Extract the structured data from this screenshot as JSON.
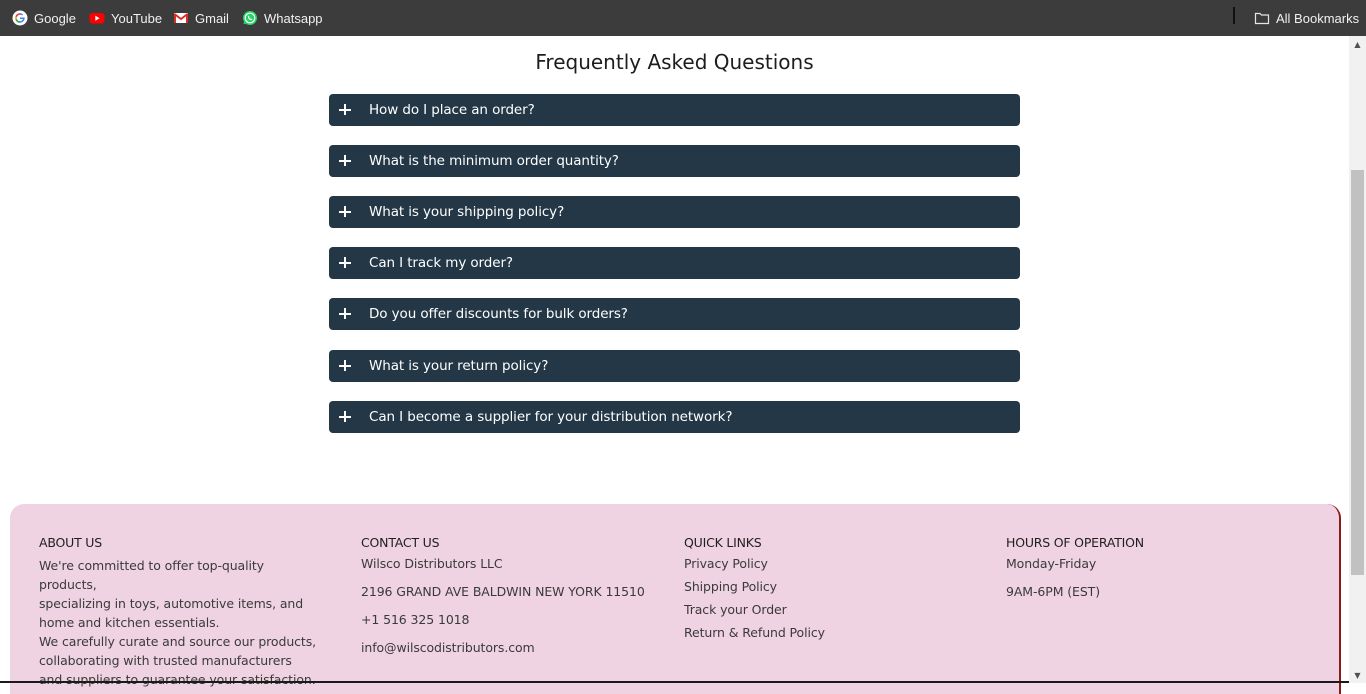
{
  "bookmarks": {
    "items": [
      {
        "label": "Google",
        "icon": "google-icon"
      },
      {
        "label": "YouTube",
        "icon": "youtube-icon"
      },
      {
        "label": "Gmail",
        "icon": "gmail-icon"
      },
      {
        "label": "Whatsapp",
        "icon": "whatsapp-icon"
      }
    ],
    "all_label": "All Bookmarks"
  },
  "faq": {
    "title": "Frequently Asked Questions",
    "questions": [
      "How do I place an order?",
      "What is the minimum order quantity?",
      "What is your shipping policy?",
      "Can I track my order?",
      "Do you offer discounts for bulk orders?",
      "What is your return policy?",
      "Can I become a supplier for your distribution network?"
    ]
  },
  "footer": {
    "about": {
      "heading": "ABOUT US",
      "lines": [
        "We're committed to offer top-quality",
        "products,",
        "specializing in toys, automotive items, and",
        "home and kitchen essentials.",
        "We carefully curate and source our products,",
        "collaborating with trusted manufacturers",
        "and suppliers to guarantee your satisfaction."
      ]
    },
    "contact": {
      "heading": "CONTACT US",
      "company": "Wilsco Distributors LLC",
      "address": "2196 GRAND AVE BALDWIN NEW YORK 11510",
      "phone": "+1 516 325 1018",
      "email": "info@wilscodistributors.com"
    },
    "quick_links": {
      "heading": "QUICK LINKS",
      "links": [
        "Privacy Policy",
        "Shipping Policy",
        "Track your Order",
        "Return & Refund Policy"
      ]
    },
    "hours": {
      "heading": "HOURS OF OPERATION",
      "days": "Monday-Friday",
      "time": "9AM-6PM (EST)"
    }
  },
  "colors": {
    "bookmarks_bar": "#3c3c3c",
    "faq_item": "#233746",
    "footer_bg": "#efd3e2"
  }
}
